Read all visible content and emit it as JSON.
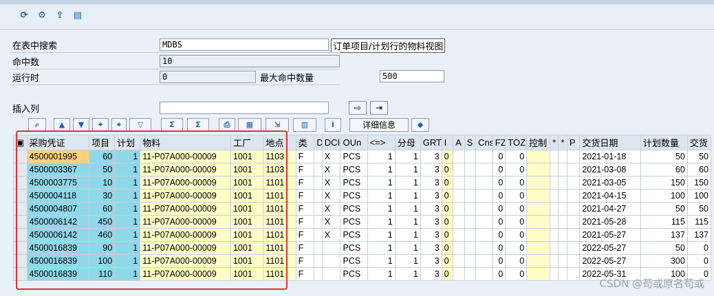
{
  "toolbar": {
    "icons": [
      "refresh-icon",
      "settings-icon",
      "export-icon",
      "document-icon"
    ]
  },
  "form": {
    "search_label": "在表中搜索",
    "search_value": "MDBS",
    "search_desc": "订单项目/计划行的物料视图",
    "hits_label": "命中数",
    "hits_value": "10",
    "runtime_label": "运行时",
    "runtime_value": "0",
    "maxhits_label": "最大命中数量",
    "maxhits_value": "500",
    "insert_label": "插入列",
    "insert_value": ""
  },
  "alv": {
    "detail_label": "详细信息"
  },
  "table": {
    "headers": [
      "采购凭证",
      "项目",
      "计划",
      "物料",
      "工厂",
      "地点",
      "类",
      "D",
      "DCI",
      "OUn",
      "<=>",
      "分母",
      "GRT",
      "I",
      "A",
      "S",
      "Cns",
      "FZ",
      "TOZ",
      "控制",
      "*",
      "*",
      "P",
      "交货日期",
      "计划数量",
      "交货"
    ],
    "rows": [
      [
        "4500001995",
        "60",
        "1",
        "11-P07A000-00009",
        "1001",
        "1103",
        "F",
        "",
        "X",
        "PCS",
        "1",
        "1",
        "3",
        "0",
        "",
        "",
        "",
        "0",
        "0",
        "",
        "",
        "",
        "",
        "2021-01-18",
        "50",
        "50"
      ],
      [
        "4500003367",
        "50",
        "1",
        "11-P07A000-00009",
        "1001",
        "1103",
        "F",
        "",
        "X",
        "PCS",
        "1",
        "1",
        "3",
        "0",
        "",
        "",
        "",
        "0",
        "0",
        "",
        "",
        "",
        "",
        "2021-03-08",
        "60",
        "60"
      ],
      [
        "4500003775",
        "10",
        "1",
        "11-P07A000-00009",
        "1001",
        "1101",
        "F",
        "",
        "X",
        "PCS",
        "1",
        "1",
        "3",
        "0",
        "",
        "",
        "",
        "0",
        "0",
        "",
        "",
        "",
        "",
        "2021-03-05",
        "150",
        "150"
      ],
      [
        "4500004118",
        "30",
        "1",
        "11-P07A000-00009",
        "1001",
        "1101",
        "F",
        "",
        "X",
        "PCS",
        "1",
        "1",
        "3",
        "0",
        "",
        "",
        "",
        "0",
        "0",
        "",
        "",
        "",
        "",
        "2021-04-15",
        "100",
        "100"
      ],
      [
        "4500004807",
        "60",
        "1",
        "11-P07A000-00009",
        "1001",
        "1101",
        "F",
        "",
        "X",
        "PCS",
        "1",
        "1",
        "3",
        "0",
        "",
        "",
        "",
        "0",
        "0",
        "",
        "",
        "",
        "",
        "2021-04-27",
        "50",
        "50"
      ],
      [
        "4500006142",
        "450",
        "1",
        "11-P07A000-00009",
        "1001",
        "1101",
        "F",
        "",
        "X",
        "PCS",
        "1",
        "1",
        "3",
        "0",
        "",
        "",
        "",
        "0",
        "0",
        "",
        "",
        "",
        "",
        "2021-05-28",
        "115",
        "115"
      ],
      [
        "4500006142",
        "460",
        "1",
        "11-P07A000-00009",
        "1001",
        "1101",
        "F",
        "",
        "X",
        "PCS",
        "1",
        "1",
        "3",
        "0",
        "",
        "",
        "",
        "0",
        "0",
        "",
        "",
        "",
        "",
        "2021-05-27",
        "137",
        "137"
      ],
      [
        "4500016839",
        "90",
        "1",
        "11-P07A000-00009",
        "1001",
        "1101",
        "F",
        "",
        "",
        "PCS",
        "1",
        "1",
        "3",
        "0",
        "",
        "",
        "",
        "0",
        "0",
        "",
        "",
        "",
        "",
        "2022-05-27",
        "50",
        "0"
      ],
      [
        "4500016839",
        "100",
        "1",
        "11-P07A000-00009",
        "1001",
        "1101",
        "F",
        "",
        "",
        "PCS",
        "1",
        "1",
        "3",
        "0",
        "",
        "",
        "",
        "0",
        "0",
        "",
        "",
        "",
        "",
        "2022-05-27",
        "300",
        "0"
      ],
      [
        "4500016839",
        "110",
        "1",
        "11-P07A000-00009",
        "1001",
        "1101",
        "F",
        "",
        "",
        "PCS",
        "1",
        "1",
        "3",
        "0",
        "",
        "",
        "",
        "0",
        "0",
        "",
        "",
        "",
        "",
        "2022-05-31",
        "100",
        "0"
      ]
    ]
  },
  "watermark": "CSDN @苟或原名苟或"
}
